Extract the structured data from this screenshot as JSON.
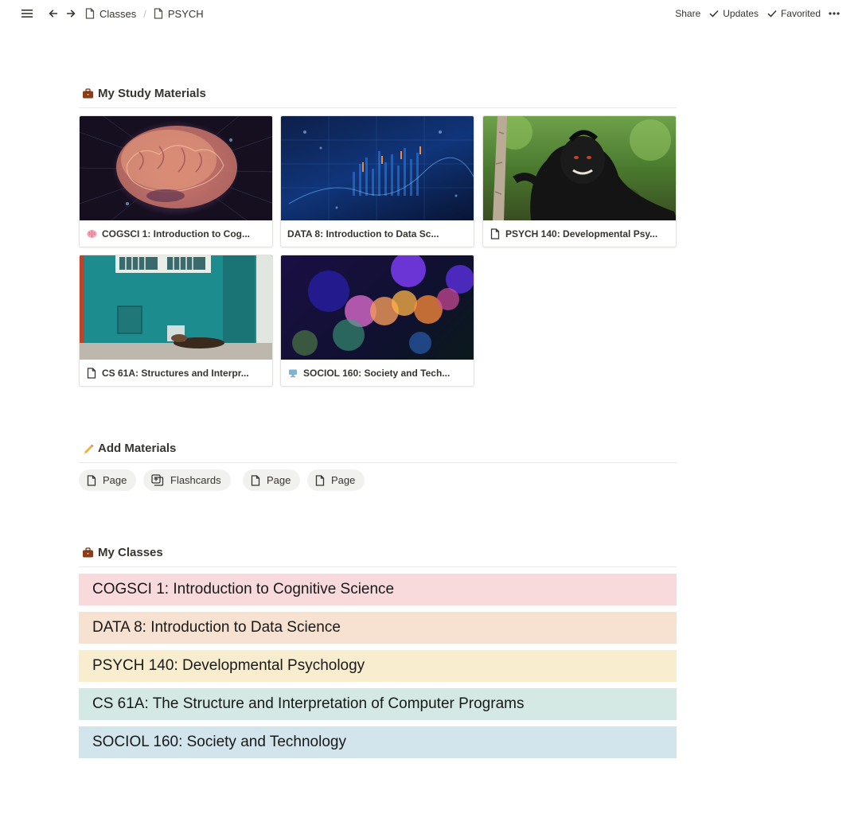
{
  "topbar": {
    "breadcrumbs": [
      {
        "label": "Classes",
        "icon": "page-icon"
      },
      {
        "label": "PSYCH",
        "icon": "page-icon"
      }
    ],
    "separator": "/",
    "share": "Share",
    "updates": "Updates",
    "favorited": "Favorited"
  },
  "study": {
    "title": "My Study Materials",
    "icon": "briefcase-icon",
    "cards": [
      {
        "label": "COGSCI 1: Introduction to Cog...",
        "icon": "brain-icon",
        "cover": "brain-cover"
      },
      {
        "label": "DATA 8: Introduction to Data Sc...",
        "icon": "",
        "cover": "data-chart-cover"
      },
      {
        "label": "PSYCH 140: Developmental Psy...",
        "icon": "page-icon",
        "cover": "monkey-cover"
      },
      {
        "label": "CS 61A: Structures and Interpr...",
        "icon": "page-icon",
        "cover": "teal-wall-cover"
      },
      {
        "label": "SOCIOL 160: Society and Tech...",
        "icon": "computer-icon",
        "cover": "bokeh-cover"
      }
    ]
  },
  "add": {
    "title": "Add Materials",
    "icon": "pencil-icon",
    "buttons": [
      {
        "label": "Page",
        "icon": "page-icon"
      },
      {
        "label": "Flashcards",
        "icon": "flashcards-icon"
      },
      {
        "label": "Page",
        "icon": "page-icon"
      },
      {
        "label": "Page",
        "icon": "page-icon"
      }
    ]
  },
  "classes": {
    "title": "My Classes",
    "icon": "briefcase-icon",
    "items": [
      {
        "label": "COGSCI 1: Introduction to Cognitive Science",
        "color": "#f8d9dc"
      },
      {
        "label": "DATA 8: Introduction to Data Science",
        "color": "#f7e2d1"
      },
      {
        "label": "PSYCH 140: Developmental Psychology",
        "color": "#f9edcf"
      },
      {
        "label": "CS 61A: The Structure and Interpretation of Computer Programs",
        "color": "#d4e9e3"
      },
      {
        "label": "SOCIOL 160: Society and Technology",
        "color": "#d2e4ec"
      }
    ]
  }
}
